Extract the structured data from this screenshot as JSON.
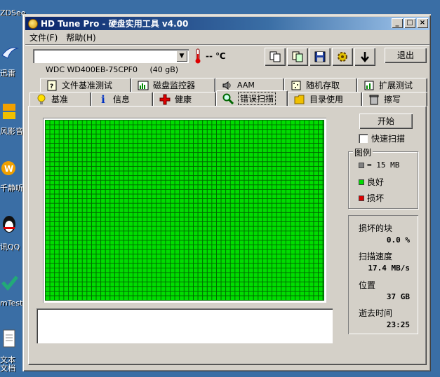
{
  "desktop_icons": [
    {
      "label": "ZDSee",
      "glyph": "blank-icon"
    },
    {
      "label": "迅雷",
      "glyph": "bird-icon"
    },
    {
      "label": "风影音",
      "glyph": "media-icon"
    },
    {
      "label": "千静听",
      "glyph": "music-icon"
    },
    {
      "label": "讯QQ",
      "glyph": "penguin-icon"
    },
    {
      "label": "mTest",
      "glyph": "check-icon"
    },
    {
      "label": "文本文档",
      "glyph": "document-icon"
    }
  ],
  "window": {
    "title": "HD Tune Pro - 硬盘实用工具 v4.00",
    "controls": {
      "minimize": "_",
      "maximize": "□",
      "close": "×"
    }
  },
  "menu": [
    "文件(F)",
    "帮助(H)"
  ],
  "toolbar": {
    "drive": "WDC WD400EB-75CPF0     (40 gB)",
    "temperature": "-- ℃",
    "exit_label": "退出"
  },
  "tabs_row1": [
    {
      "label": "文件基准测试",
      "icon": "file-icon"
    },
    {
      "label": "磁盘监控器",
      "icon": "monitor-icon"
    },
    {
      "label": "AAM",
      "icon": "speaker-icon"
    },
    {
      "label": "随机存取",
      "icon": "random-icon"
    },
    {
      "label": "扩展测试",
      "icon": "extend-icon"
    }
  ],
  "tabs_row2": [
    {
      "label": "基准",
      "icon": "bulb-icon"
    },
    {
      "label": "信息",
      "icon": "info-icon"
    },
    {
      "label": "健康",
      "icon": "cross-icon"
    },
    {
      "label": "错误扫描",
      "icon": "magnifier-icon"
    },
    {
      "label": "目录使用",
      "icon": "folder-icon"
    },
    {
      "label": "擦写",
      "icon": "trash-icon"
    }
  ],
  "scan": {
    "start_label": "开始",
    "quick_scan_label": "快速扫描",
    "quick_scan_checked": false
  },
  "legend": {
    "title": "图例",
    "block_size": "= 15 MB",
    "good": "良好",
    "bad": "损坏",
    "colors": {
      "block": "#808080",
      "good": "#00dd00",
      "bad": "#dd0000"
    }
  },
  "stats": {
    "damaged_label": "损坏的块",
    "damaged_value": "0.0 %",
    "speed_label": "扫描速度",
    "speed_value": "17.4 MB/s",
    "position_label": "位置",
    "position_value": "37 GB",
    "elapsed_label": "逝去时间",
    "elapsed_value": "23:25"
  }
}
